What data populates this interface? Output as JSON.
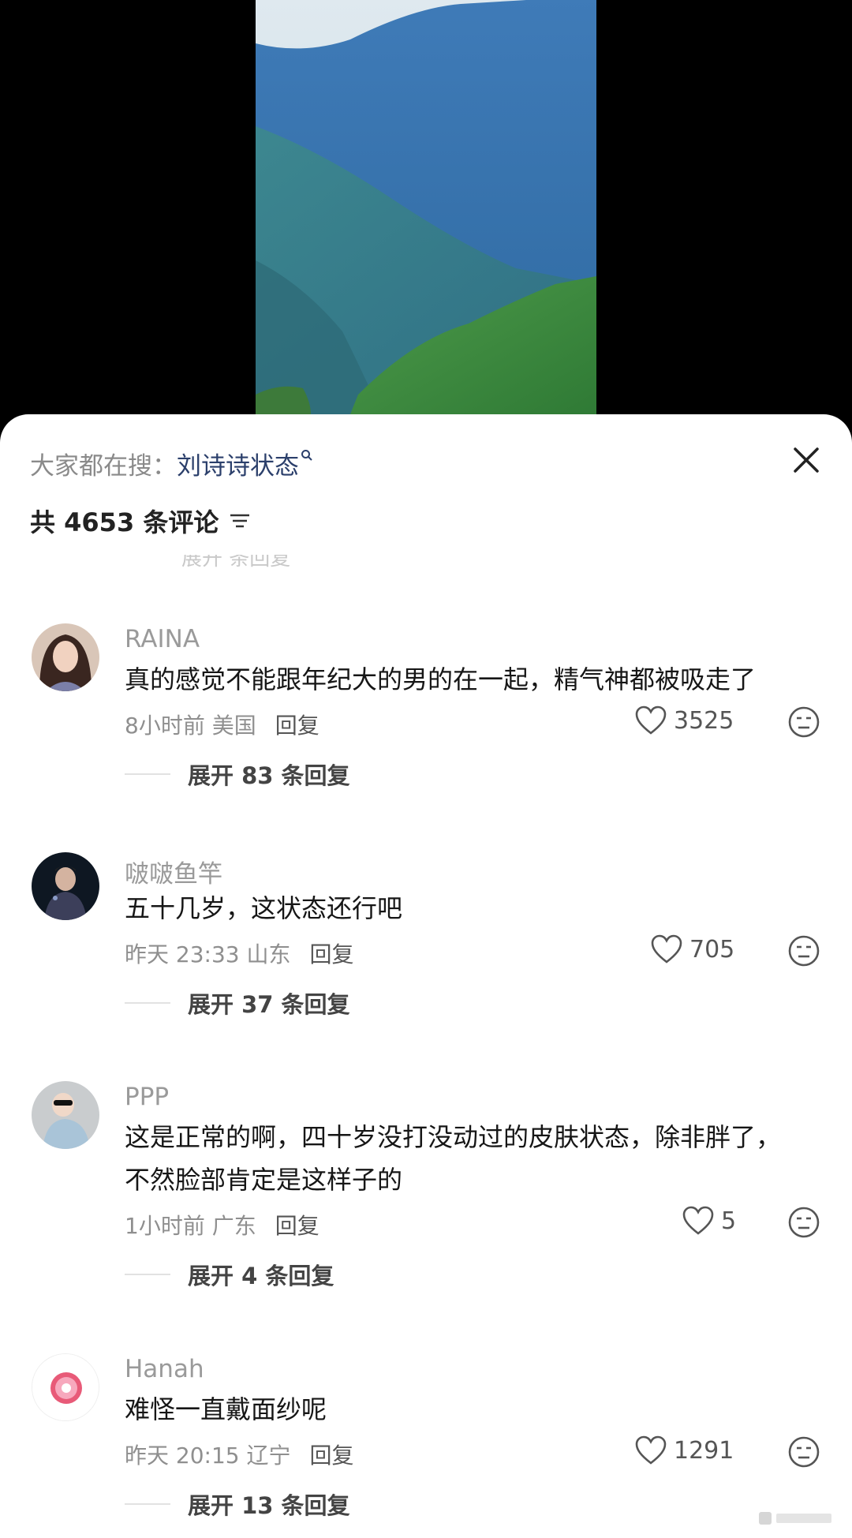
{
  "header": {
    "search_prefix": "大家都在搜：",
    "search_term": "刘诗诗状态",
    "comment_count_label": "共 4653 条评论"
  },
  "hidden_row": "展开   条回复",
  "comments": [
    {
      "username": "RAINA",
      "text": "真的感觉不能跟年纪大的男的在一起，精气神都被吸走了",
      "time_location": "8小时前 美国",
      "reply_label": "回复",
      "likes": "3525",
      "expand_label": "展开 83 条回复"
    },
    {
      "username": "啵啵鱼竿",
      "text": "五十几岁，这状态还行吧",
      "time_location": "昨天 23:33 山东",
      "reply_label": "回复",
      "likes": "705",
      "expand_label": "展开 37 条回复"
    },
    {
      "username": "PPP",
      "text": "这是正常的啊，四十岁没打没动过的皮肤状态，除非胖了，不然脸部肯定是这样子的",
      "time_location": "1小时前 广东",
      "reply_label": "回复",
      "likes": "5",
      "expand_label": "展开 4 条回复"
    },
    {
      "username": "Hanah",
      "text": "难怪一直戴面纱呢",
      "time_location": "昨天 20:15 辽宁",
      "reply_label": "回复",
      "likes": "1291",
      "expand_label": "展开 13 条回复"
    }
  ],
  "icons": {
    "close": "close-icon",
    "sort": "sort-icon",
    "search": "search-icon",
    "like": "heart-icon",
    "dislike": "dislike-face-icon"
  },
  "colors": {
    "search_term": "#2b3f6b",
    "sheet_background": "#ffffff",
    "page_background": "#000000"
  }
}
